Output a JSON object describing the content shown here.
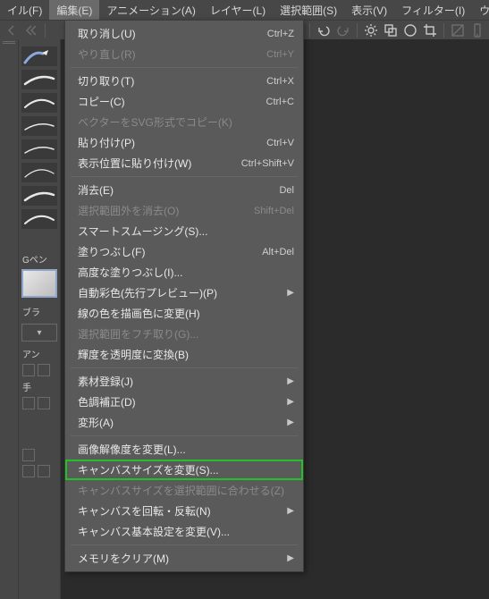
{
  "menubar": {
    "items": [
      {
        "label": "イル(F)"
      },
      {
        "label": "編集(E)",
        "active": true
      },
      {
        "label": "アニメーション(A)"
      },
      {
        "label": "レイヤー(L)"
      },
      {
        "label": "選択範囲(S)"
      },
      {
        "label": "表示(V)"
      },
      {
        "label": "フィルター(I)"
      },
      {
        "label": "ウィンドウ"
      }
    ]
  },
  "brushcol": {
    "label_gpen": "Gペン",
    "label_brush": "ブラ",
    "label_an": "アン",
    "label_hand": "手"
  },
  "menu": {
    "groups": [
      [
        {
          "label": "取り消し(U)",
          "shortcut": "Ctrl+Z"
        },
        {
          "label": "やり直し(R)",
          "shortcut": "Ctrl+Y",
          "disabled": true
        }
      ],
      [
        {
          "label": "切り取り(T)",
          "shortcut": "Ctrl+X"
        },
        {
          "label": "コピー(C)",
          "shortcut": "Ctrl+C"
        },
        {
          "label": "ベクターをSVG形式でコピー(K)",
          "disabled": true
        },
        {
          "label": "貼り付け(P)",
          "shortcut": "Ctrl+V"
        },
        {
          "label": "表示位置に貼り付け(W)",
          "shortcut": "Ctrl+Shift+V"
        }
      ],
      [
        {
          "label": "消去(E)",
          "shortcut": "Del"
        },
        {
          "label": "選択範囲外を消去(O)",
          "shortcut": "Shift+Del",
          "disabled": true
        },
        {
          "label": "スマートスムージング(S)..."
        },
        {
          "label": "塗りつぶし(F)",
          "shortcut": "Alt+Del"
        },
        {
          "label": "高度な塗りつぶし(I)..."
        },
        {
          "label": "自動彩色(先行プレビュー)(P)",
          "submenu": true
        },
        {
          "label": "線の色を描画色に変更(H)"
        },
        {
          "label": "選択範囲をフチ取り(G)...",
          "disabled": true
        },
        {
          "label": "輝度を透明度に変換(B)"
        }
      ],
      [
        {
          "label": "素材登録(J)",
          "submenu": true
        },
        {
          "label": "色調補正(D)",
          "submenu": true
        },
        {
          "label": "変形(A)",
          "submenu": true
        }
      ],
      [
        {
          "label": "画像解像度を変更(L)..."
        },
        {
          "label": "キャンバスサイズを変更(S)...",
          "highlighted": true
        },
        {
          "label": "キャンバスサイズを選択範囲に合わせる(Z)",
          "disabled": true
        },
        {
          "label": "キャンバスを回転・反転(N)",
          "submenu": true
        },
        {
          "label": "キャンバス基本設定を変更(V)..."
        }
      ],
      [
        {
          "label": "メモリをクリア(M)",
          "submenu": true
        }
      ]
    ]
  }
}
